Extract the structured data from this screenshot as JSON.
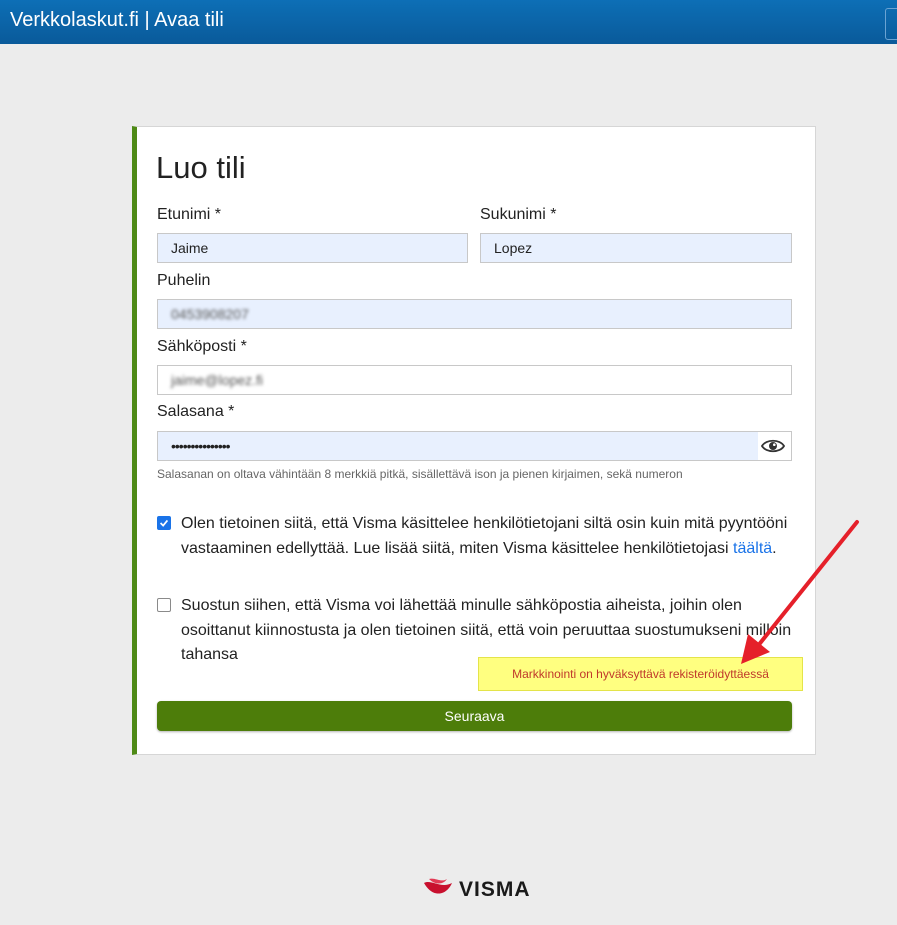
{
  "header": {
    "title": "Verkkolaskut.fi | Avaa tili"
  },
  "form": {
    "heading": "Luo tili",
    "first_name": {
      "label": "Etunimi *",
      "value": "Jaime"
    },
    "last_name": {
      "label": "Sukunimi *",
      "value": "Lopez"
    },
    "phone": {
      "label": "Puhelin",
      "value": "0453908207"
    },
    "email": {
      "label": "Sähköposti *",
      "value": "jaime@lopez.fi"
    },
    "password": {
      "label": "Salasana *",
      "value": "•••••••••••••••",
      "hint": "Salasanan on oltava vähintään 8 merkkiä pitkä, sisällettävä ison ja pienen kirjaimen, sekä numeron"
    },
    "privacy": {
      "checked": true,
      "line1": "Olen tietoinen siitä, että Visma käsittelee henkilötietojani siltä osin kuin mitä pyyntööni",
      "line2": "vastaaminen edellyttää. Lue lisää siitä, miten Visma käsittelee henkilötietojasi",
      "link": "täältä",
      "after": "."
    },
    "marketing": {
      "checked": false,
      "line1": "Suostun siihen, että Visma voi lähettää minulle sähköpostia aiheista, joihin olen",
      "line2": "osoittanut kiinnostusta ja olen tietoinen siitä, että voin peruuttaa suostumukseni milloin",
      "line3": "tahansa"
    },
    "warning": "Markkinointi on hyväksyttävä rekisteröidyttäessä",
    "submit": "Seuraava"
  },
  "footer": {
    "brand": "VISMA"
  },
  "colors": {
    "header": "#0d6fb6",
    "accent": "#4e8a16",
    "button": "#4d7d0a",
    "link": "#1a73e8",
    "warning_bg": "#ffff80",
    "warning_text": "#c0392b",
    "arrow": "#e5202a"
  },
  "icons": {
    "password_toggle": "eye-icon",
    "logo": "visma-logo-icon",
    "annotation": "red-arrow-icon"
  }
}
